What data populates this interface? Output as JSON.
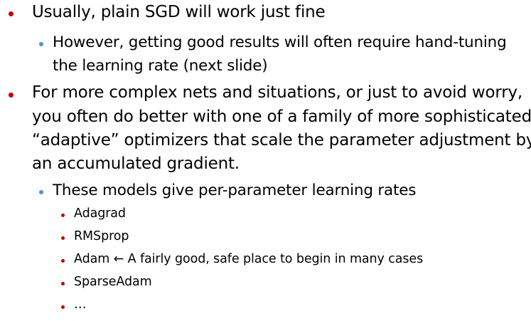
{
  "colors": {
    "level1_bullet": "#c00000",
    "level2_bullet": "#4f8fe0",
    "level3_bullet": "#c00000",
    "text": "#000000"
  },
  "bullets": [
    {
      "level": 1,
      "lines": [
        "Usually, plain SGD will work just fine"
      ]
    },
    {
      "level": 2,
      "lines": [
        "However, getting good results will often require hand-tuning",
        "the learning rate (next slide)"
      ]
    },
    {
      "level": 1,
      "lines": [
        "For more complex nets and situations, or just to avoid worry,",
        "you often do better with one of a family of more sophisticated",
        "“adaptive” optimizers that scale the parameter adjustment by",
        "an accumulated gradient."
      ]
    },
    {
      "level": 2,
      "lines": [
        "These models give per-parameter learning rates"
      ]
    },
    {
      "level": 3,
      "lines": [
        "Adagrad"
      ]
    },
    {
      "level": 3,
      "lines": [
        "RMSprop"
      ]
    },
    {
      "level": 3,
      "lines": [
        "Adam  ← A fairly good, safe place to begin in many cases"
      ]
    },
    {
      "level": 3,
      "lines": [
        "SparseAdam"
      ]
    },
    {
      "level": 3,
      "lines": [
        "…"
      ]
    }
  ]
}
